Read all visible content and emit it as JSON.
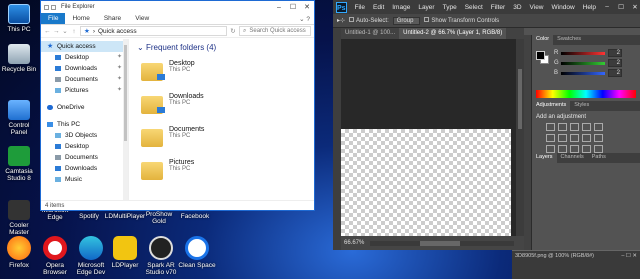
{
  "desktop": {
    "icons": [
      "This PC",
      "Recycle Bin",
      "Control Panel",
      "Camtasia Studio 8",
      "Cooler Master"
    ],
    "row_labels": [
      "Microsoft Edge",
      "Spotify",
      "LDMultiPlayer",
      "ProShow Gold",
      "Facebook"
    ],
    "taskbar_icons": [
      "Firefox",
      "Opera Browser",
      "Microsoft Edge Dev",
      "LDPlayer",
      "Spark AR Studio v70",
      "Clean Space"
    ]
  },
  "explorer": {
    "title": "File Explorer",
    "ribbon_tabs": [
      "File",
      "Home",
      "Share",
      "View"
    ],
    "address": "Quick access",
    "search_placeholder": "Search Quick access",
    "nav": {
      "quick_access": "Quick access",
      "qa_items": [
        "Desktop",
        "Downloads",
        "Documents",
        "Pictures"
      ],
      "onedrive": "OneDrive",
      "this_pc": "This PC",
      "pc_items": [
        "3D Objects",
        "Desktop",
        "Documents",
        "Downloads",
        "Music"
      ]
    },
    "group_title": "Frequent folders (4)",
    "folders": [
      {
        "name": "Desktop",
        "location": "This PC"
      },
      {
        "name": "Downloads",
        "location": "This PC"
      },
      {
        "name": "Documents",
        "location": "This PC"
      },
      {
        "name": "Pictures",
        "location": "This PC"
      }
    ],
    "status": "4 items"
  },
  "photoshop": {
    "logo": "Ps",
    "menu": [
      "File",
      "Edit",
      "Image",
      "Layer",
      "Type",
      "Select",
      "Filter",
      "3D",
      "View",
      "Window",
      "Help"
    ],
    "options": {
      "auto_select": "Auto-Select:",
      "group": "Group",
      "transform": "Show Transform Controls"
    },
    "tabs": [
      "Untitled-1 @ 100...",
      "Untitled-2 @ 66.7% (Layer 1, RGB/8)"
    ],
    "zoom": "66.67%",
    "color_tabs": [
      "Color",
      "Swatches"
    ],
    "sliders": [
      {
        "label": "R",
        "value": "2",
        "color": "#ff3333"
      },
      {
        "label": "G",
        "value": "2",
        "color": "#33cc33"
      },
      {
        "label": "B",
        "value": "2",
        "color": "#3366ff"
      }
    ],
    "adj_tabs": [
      "Adjustments",
      "Styles"
    ],
    "adj_add": "Add an adjustment",
    "layer_tabs": [
      "Layers",
      "Channels",
      "Paths"
    ]
  },
  "ps2": {
    "title": "3D8905f.png @ 100% (RGB/8#)"
  }
}
